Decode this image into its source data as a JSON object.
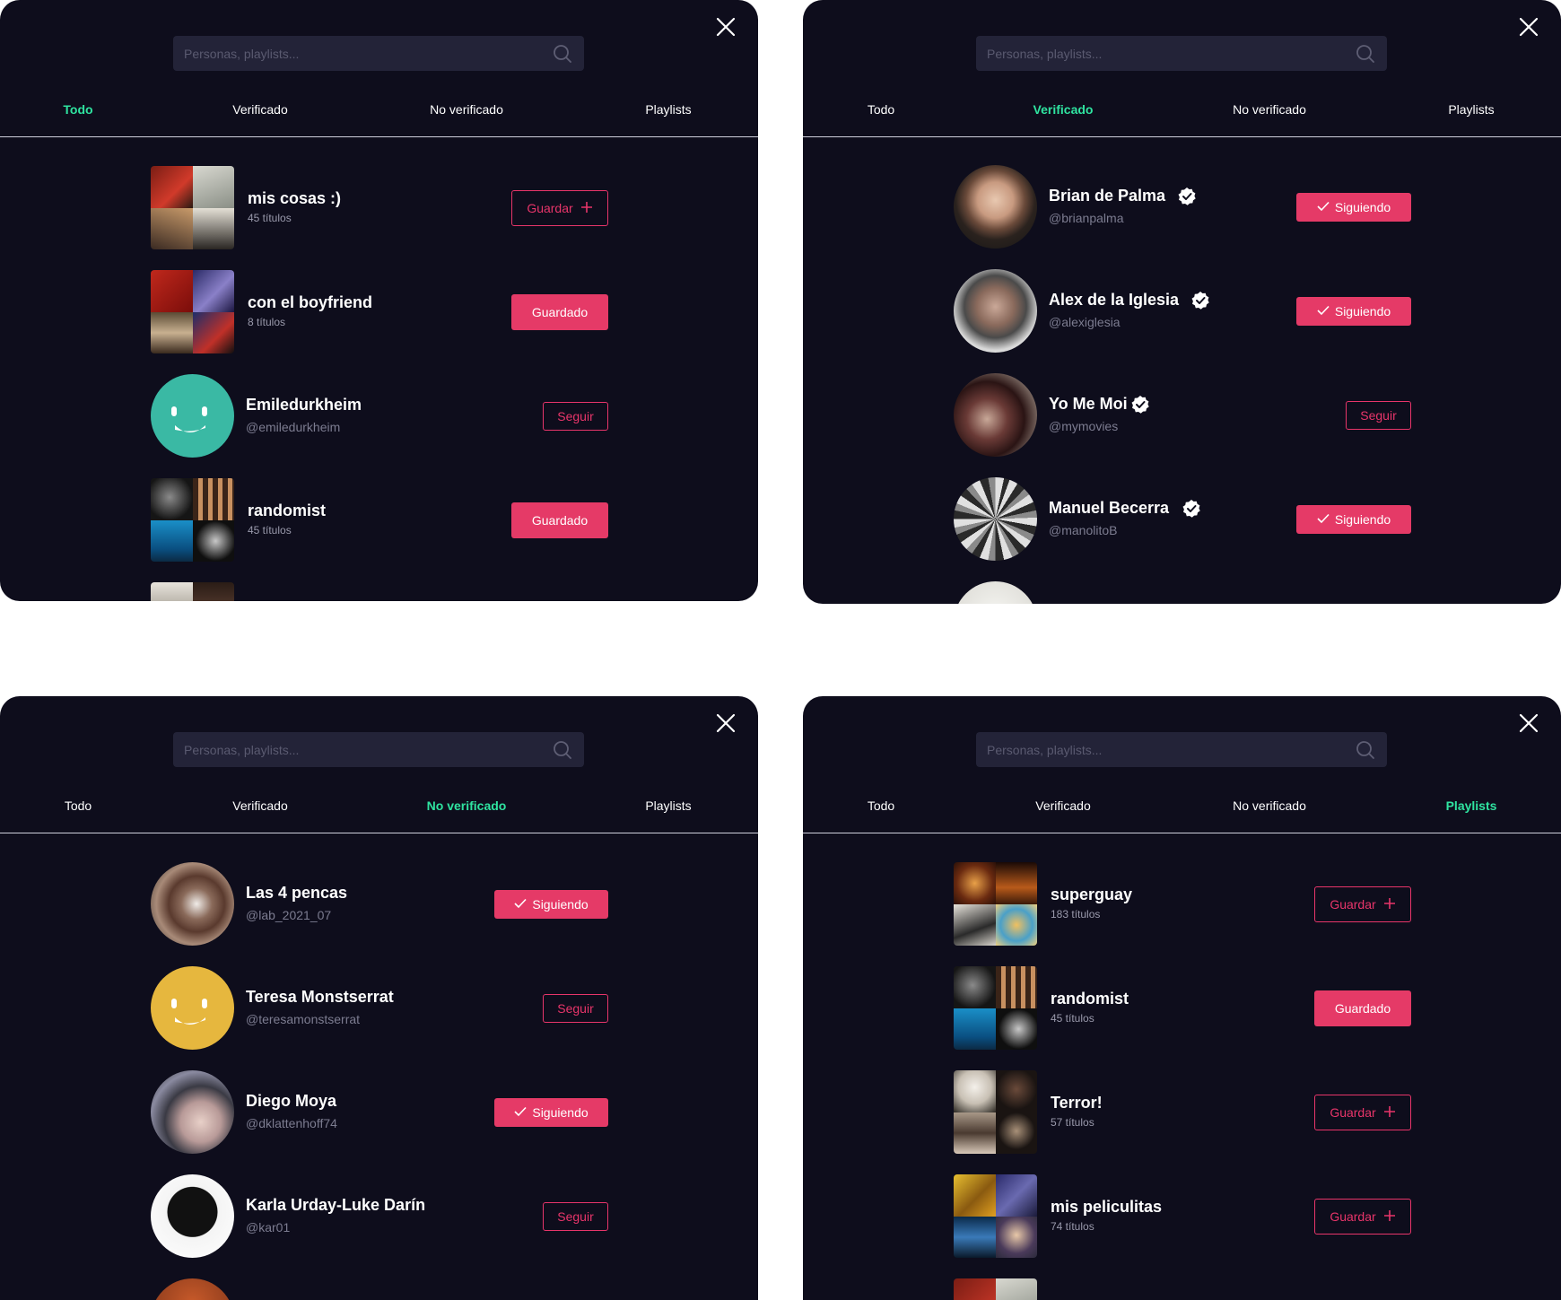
{
  "common": {
    "search_placeholder": "Personas, playlists...",
    "tabs": [
      "Todo",
      "Verificado",
      "No verificado",
      "Playlists"
    ]
  },
  "panels": [
    {
      "active_tab": "Todo",
      "rows": [
        {
          "kind": "playlist",
          "title": "mis cosas :)",
          "subtitle": "45 títulos",
          "button": "Guardar"
        },
        {
          "kind": "playlist",
          "title": "con el boyfriend",
          "subtitle": "8 títulos",
          "button": "Guardado"
        },
        {
          "kind": "person",
          "title": "Emiledurkheim",
          "subtitle": "@emiledurkheim",
          "button": "Seguir"
        },
        {
          "kind": "playlist",
          "title": "randomist",
          "subtitle": "45 títulos",
          "button": "Guardado"
        }
      ]
    },
    {
      "active_tab": "Verificado",
      "rows": [
        {
          "kind": "person",
          "title": "Brian de Palma",
          "subtitle": "@brianpalma",
          "button": "Siguiendo"
        },
        {
          "kind": "person",
          "title": "Alex de la Iglesia",
          "subtitle": "@alexiglesia",
          "button": "Siguiendo"
        },
        {
          "kind": "person",
          "title": "Yo Me Moi",
          "subtitle": "@mymovies",
          "button": "Seguir"
        },
        {
          "kind": "person",
          "title": "Manuel Becerra",
          "subtitle": "@manolitoB",
          "button": "Siguiendo"
        }
      ]
    },
    {
      "active_tab": "No verificado",
      "rows": [
        {
          "kind": "person",
          "title": "Las 4 pencas",
          "subtitle": "@lab_2021_07",
          "button": "Siguiendo"
        },
        {
          "kind": "person",
          "title": "Teresa Monstserrat",
          "subtitle": "@teresamonstserrat",
          "button": "Seguir"
        },
        {
          "kind": "person",
          "title": "Diego Moya",
          "subtitle": "@dklattenhoff74",
          "button": "Siguiendo"
        },
        {
          "kind": "person",
          "title": "Karla Urday-Luke Darín",
          "subtitle": "@kar01",
          "button": "Seguir"
        }
      ]
    },
    {
      "active_tab": "Playlists",
      "rows": [
        {
          "kind": "playlist",
          "title": "superguay",
          "subtitle": "183 títulos",
          "button": "Guardar"
        },
        {
          "kind": "playlist",
          "title": "randomist",
          "subtitle": "45 títulos",
          "button": "Guardado"
        },
        {
          "kind": "playlist",
          "title": "Terror!",
          "subtitle": "57 títulos",
          "button": "Guardar"
        },
        {
          "kind": "playlist",
          "title": "mis peliculitas",
          "subtitle": "74 títulos",
          "button": "Guardar"
        }
      ]
    }
  ],
  "colors": {
    "panel_bg": "#0e0d1c",
    "accent_active_tab": "#2fe3a0",
    "button_pink": "#e53a67",
    "search_bg": "#232338"
  },
  "icons": [
    "close-icon",
    "search-icon",
    "plus-icon",
    "check-icon",
    "verified-badge-icon",
    "smiley-avatar-icon"
  ]
}
